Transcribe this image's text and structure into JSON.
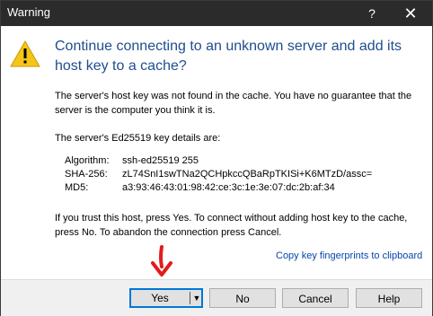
{
  "window": {
    "title": "Warning",
    "help_glyph": "?",
    "close_glyph": "✕"
  },
  "heading": "Continue connecting to an unknown server and add its host key to a cache?",
  "paragraphs": {
    "p1": "The server's host key was not found in the cache. You have no guarantee that the server is the computer you think it is.",
    "p2": "The server's Ed25519 key details are:",
    "p3": "If you trust this host, press Yes. To connect without adding host key to the cache, press No. To abandon the connection press Cancel."
  },
  "key_details": [
    {
      "key": "Algorithm:",
      "value": "ssh-ed25519 255"
    },
    {
      "key": "SHA-256:",
      "value": "zL74SnI1swTNa2QCHpkccQBaRpTKISi+K6MTzD/assc="
    },
    {
      "key": "MD5:",
      "value": "a3:93:46:43:01:98:42:ce:3c:1e:3e:07:dc:2b:af:34"
    }
  ],
  "link": "Copy key fingerprints to clipboard",
  "buttons": {
    "yes": "Yes",
    "yes_dropdown": "▼",
    "no": "No",
    "cancel": "Cancel",
    "help": "Help"
  },
  "icons": {
    "warning": "warning-icon",
    "arrow": "red-down-arrow-icon"
  },
  "colors": {
    "titlebar": "#2b2b2b",
    "heading": "#1f4d8f",
    "link": "#0645ad",
    "focus": "#0078d7",
    "arrow": "#e31b1b",
    "warning": "#f5c518"
  }
}
